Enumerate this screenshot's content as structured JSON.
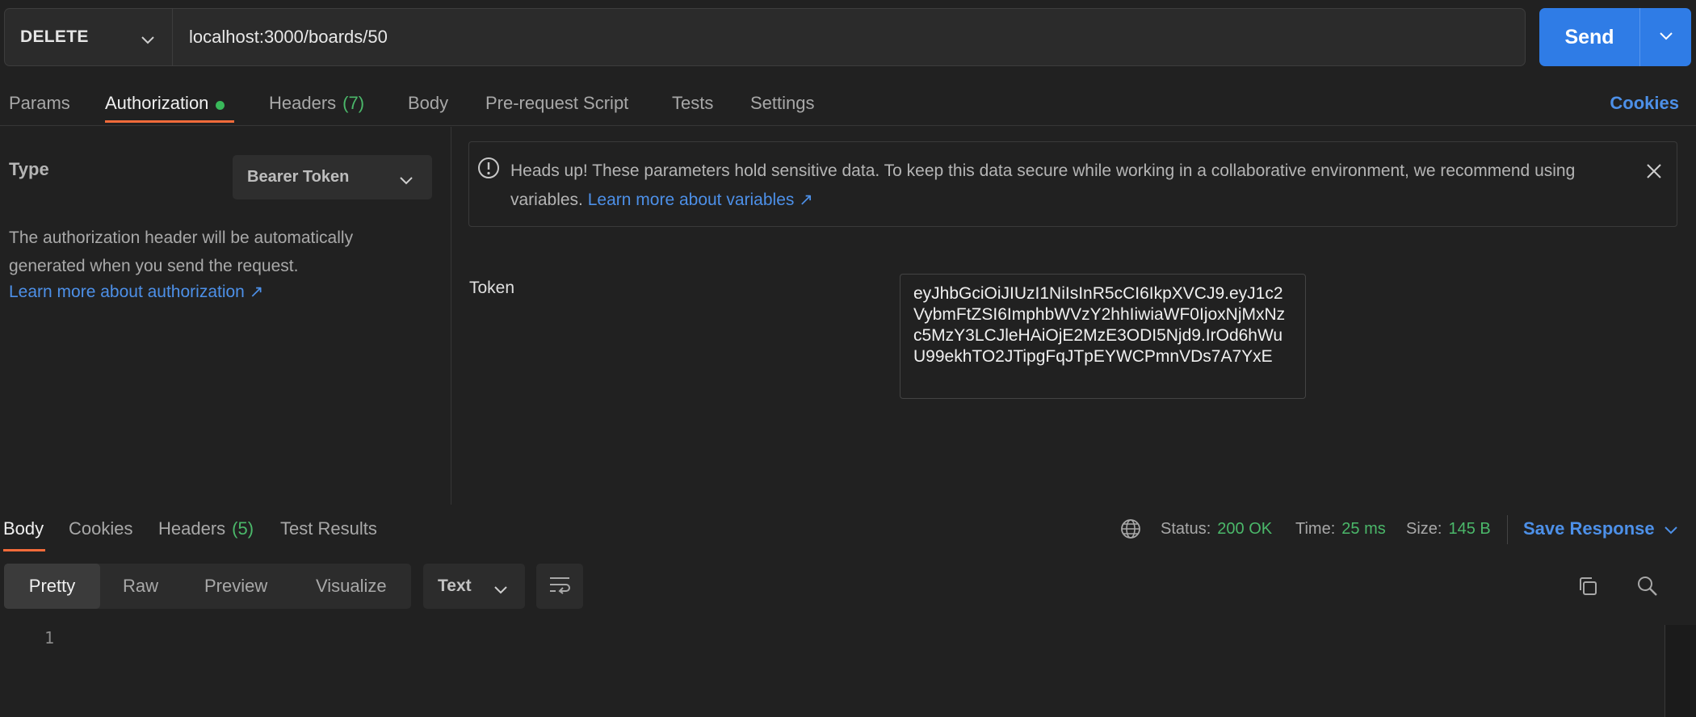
{
  "request": {
    "method": "DELETE",
    "url": "localhost:3000/boards/50",
    "send_label": "Send"
  },
  "tabs": [
    {
      "label": "Params"
    },
    {
      "label": "Authorization"
    },
    {
      "label": "Headers",
      "count": "(7)"
    },
    {
      "label": "Body"
    },
    {
      "label": "Pre-request Script"
    },
    {
      "label": "Tests"
    },
    {
      "label": "Settings"
    }
  ],
  "cookies_link": "Cookies",
  "auth": {
    "type_label": "Type",
    "type_value": "Bearer Token",
    "description": "The authorization header will be automatically generated when you send the request.",
    "learn_more": "Learn more about authorization ↗",
    "notice": "Heads up! These parameters hold sensitive data. To keep this data secure while working in a collaborative environment, we recommend using variables.",
    "notice_link": "Learn more about variables ↗",
    "token_label": "Token",
    "token_value": "eyJhbGciOiJIUzI1NiIsInR5cCI6IkpXVCJ9.eyJ1c2VybmFtZSI6ImphbWVzY2hhIiwiaWF0IjoxNjMxNzc5MzY3LCJleHAiOjE2MzE3ODI5Njd9.IrOd6hWuU99ekhTO2JTipgFqJTpEYWCPmnVDs7A7YxE"
  },
  "response": {
    "tabs": [
      {
        "label": "Body"
      },
      {
        "label": "Cookies"
      },
      {
        "label": "Headers",
        "count": "(5)"
      },
      {
        "label": "Test Results"
      }
    ],
    "status_label": "Status:",
    "status_value": "200 OK",
    "time_label": "Time:",
    "time_value": "25 ms",
    "size_label": "Size:",
    "size_value": "145 B",
    "save_label": "Save Response",
    "views": [
      "Pretty",
      "Raw",
      "Preview",
      "Visualize"
    ],
    "format": "Text",
    "line_numbers": [
      "1"
    ]
  },
  "colors": {
    "accent_blue": "#2f7ce6",
    "link_blue": "#4d90e8",
    "success_green": "#4bb86a",
    "active_underline": "#f26b3a"
  }
}
